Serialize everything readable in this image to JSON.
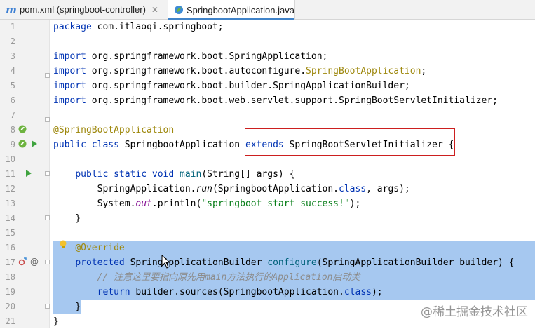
{
  "tabs": [
    {
      "label": "pom.xml (springboot-controller)",
      "icon": "maven-icon",
      "active": false
    },
    {
      "label": "SpringbootApplication.java",
      "icon": "spring-java-file-icon",
      "active": true
    }
  ],
  "editor": {
    "lines": [
      {
        "n": "1",
        "text": "package com.itlaoqi.springboot;"
      },
      {
        "n": "2",
        "text": ""
      },
      {
        "n": "3",
        "text": "import org.springframework.boot.SpringApplication;"
      },
      {
        "n": "4",
        "text": "import org.springframework.boot.autoconfigure.SpringBootApplication;"
      },
      {
        "n": "5",
        "text": "import org.springframework.boot.builder.SpringApplicationBuilder;"
      },
      {
        "n": "6",
        "text": "import org.springframework.boot.web.servlet.support.SpringBootServletInitializer;"
      },
      {
        "n": "7",
        "text": ""
      },
      {
        "n": "8",
        "text": "@SpringBootApplication"
      },
      {
        "n": "9",
        "text": "public class SpringbootApplication extends SpringBootServletInitializer {"
      },
      {
        "n": "10",
        "text": ""
      },
      {
        "n": "11",
        "text": "    public static void main(String[] args) {"
      },
      {
        "n": "12",
        "text": "        SpringApplication.run(SpringbootApplication.class, args);"
      },
      {
        "n": "13",
        "text": "        System.out.println(\"springboot start success!\");"
      },
      {
        "n": "14",
        "text": "    }"
      },
      {
        "n": "15",
        "text": ""
      },
      {
        "n": "16",
        "text": "    @Override"
      },
      {
        "n": "17",
        "text": "    protected SpringApplicationBuilder configure(SpringApplicationBuilder builder) {"
      },
      {
        "n": "18",
        "text": "        // 注意这里要指向原先用main方法执行的Application启动类"
      },
      {
        "n": "19",
        "text": "        return builder.sources(SpringbootApplication.class);"
      },
      {
        "n": "20",
        "text": "    }"
      },
      {
        "n": "21",
        "text": "}"
      }
    ]
  },
  "watermark": "@稀土掘金技术社区",
  "colors": {
    "selection": "#a6c8f0",
    "highlight_box": "#cc1f1f",
    "keyword": "#0033b3",
    "annotation": "#9e880d"
  }
}
